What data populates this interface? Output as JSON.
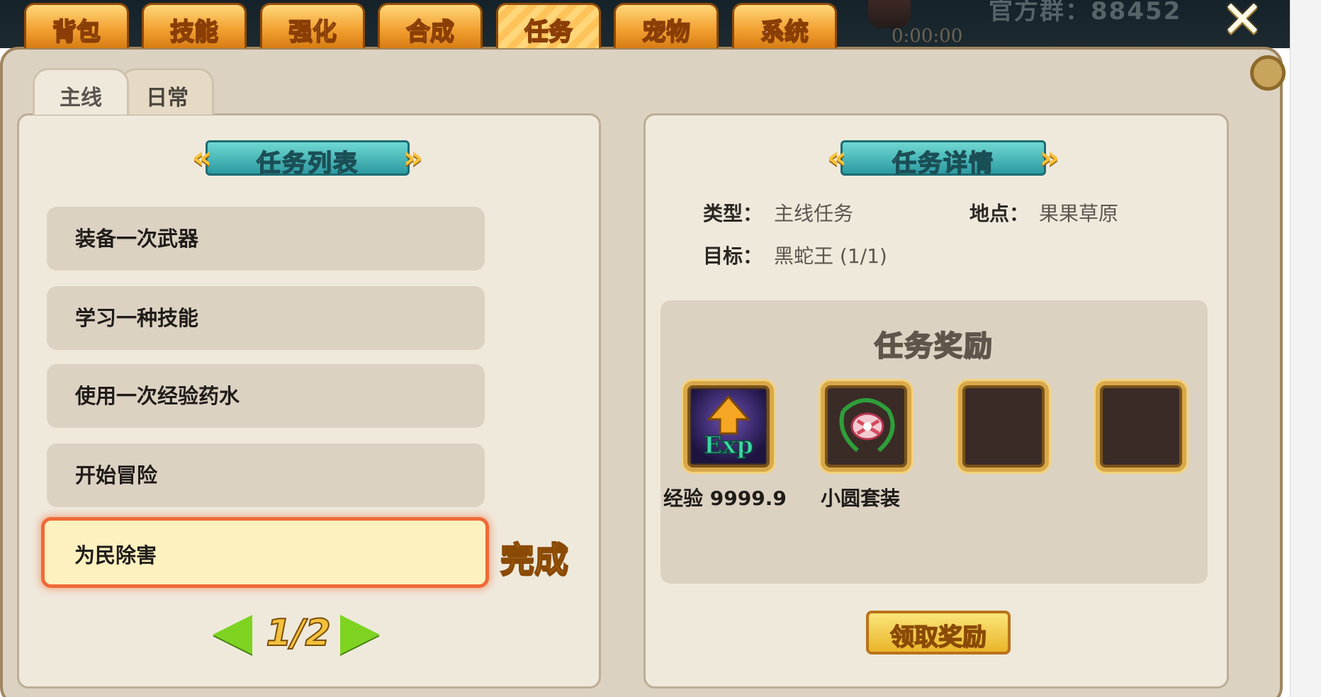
{
  "header": {
    "tabs": [
      {
        "label": "背包",
        "active": false
      },
      {
        "label": "技能",
        "active": false
      },
      {
        "label": "强化",
        "active": false
      },
      {
        "label": "合成",
        "active": false
      },
      {
        "label": "任务",
        "active": true
      },
      {
        "label": "宠物",
        "active": false
      },
      {
        "label": "系统",
        "active": false
      }
    ],
    "power_text": "官方群：88452",
    "timer": "0:00:00",
    "close_icon": "close-x-icon"
  },
  "subtabs": [
    {
      "label": "主线",
      "active": true
    },
    {
      "label": "日常",
      "active": false
    }
  ],
  "quest_list": {
    "title": "任务列表",
    "items": [
      {
        "label": "装备一次武器",
        "selected": false
      },
      {
        "label": "学习一种技能",
        "selected": false
      },
      {
        "label": "使用一次经验药水",
        "selected": false
      },
      {
        "label": "开始冒险",
        "selected": false
      },
      {
        "label": "为民除害",
        "selected": true
      }
    ],
    "status_badge": "完成",
    "pager": {
      "current": 1,
      "total": 2,
      "text": "1/2"
    }
  },
  "quest_detail": {
    "title": "任务详情",
    "type_label": "类型：",
    "type_value": "主线任务",
    "location_label": "地点：",
    "location_value": "果果草原",
    "target_label": "目标：",
    "target_value": "黑蛇王 (1/1)",
    "rewards_title": "任务奖励",
    "rewards": [
      {
        "icon": "exp-icon",
        "name": "经验 9999.9"
      },
      {
        "icon": "bow-outfit-icon",
        "name": "小圆套装"
      },
      {
        "icon": "empty-slot",
        "name": ""
      },
      {
        "icon": "empty-slot",
        "name": ""
      }
    ],
    "claim_button": "领取奖励"
  },
  "colors": {
    "tab_orange": "#f3a233",
    "ribbon_teal": "#2c9aa2",
    "selected_border": "#f06a37",
    "complete_gold": "#f6b81a",
    "pager_green": "#7ed321"
  }
}
